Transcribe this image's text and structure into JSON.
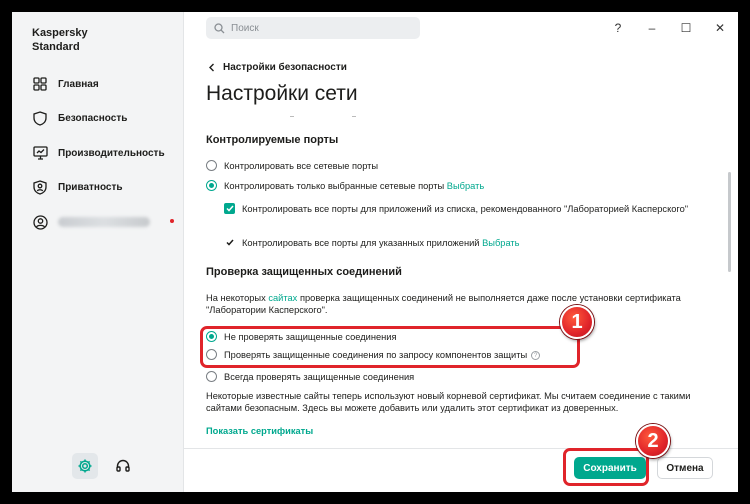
{
  "app": {
    "brand_line1": "Kaspersky",
    "brand_line2": "Standard"
  },
  "sidebar": {
    "items": [
      {
        "label": "Главная",
        "icon": "grid-icon"
      },
      {
        "label": "Безопасность",
        "icon": "shield-icon"
      },
      {
        "label": "Производительность",
        "icon": "monitor-icon"
      },
      {
        "label": "Приватность",
        "icon": "privacy-shield-icon"
      }
    ],
    "account_notification_color": "#e0242a"
  },
  "titlebar": {
    "search_placeholder": "Поиск",
    "help": "?",
    "minimize": "–",
    "maximize": "☐",
    "close": "✕"
  },
  "breadcrumb": {
    "back_label": "Настройки безопасности"
  },
  "page": {
    "title": "Настройки сети"
  },
  "ports": {
    "title": "Контролируемые порты",
    "option_all": "Контролировать все сетевые порты",
    "option_selected": "Контролировать только выбранные сетевые порты",
    "option_selected_link": "Выбрать",
    "sub_apps": "Контролировать все порты для приложений из списка, рекомендованного \"Лабораторией Касперского\"",
    "sub_specified": "Контролировать все порты для указанных приложений",
    "sub_specified_link": "Выбрать"
  },
  "secure": {
    "title": "Проверка защищенных соединений",
    "desc_prefix": "На некоторых",
    "desc_link": "сайтах",
    "desc_suffix": "проверка защищенных соединений не выполняется даже после установки сертификата \"Лаборатории Касперского\".",
    "option_none": "Не проверять защищенные соединения",
    "option_on_request": "Проверять защищенные соединения по запросу компонентов защиты",
    "option_always": "Всегда проверять защищенные соединения",
    "note": "Некоторые известные сайты теперь используют новый корневой сертификат. Мы считаем соединение с такими сайтами безопасным. Здесь вы можете добавить или удалить этот сертификат из доверенных.",
    "show_certs": "Показать сертификаты"
  },
  "footer": {
    "save_label": "Сохранить",
    "cancel_label": "Отмена"
  },
  "annotations": {
    "badge1": "1",
    "badge2": "2",
    "color": "#e0242a"
  },
  "colors": {
    "accent": "#00a88e"
  }
}
